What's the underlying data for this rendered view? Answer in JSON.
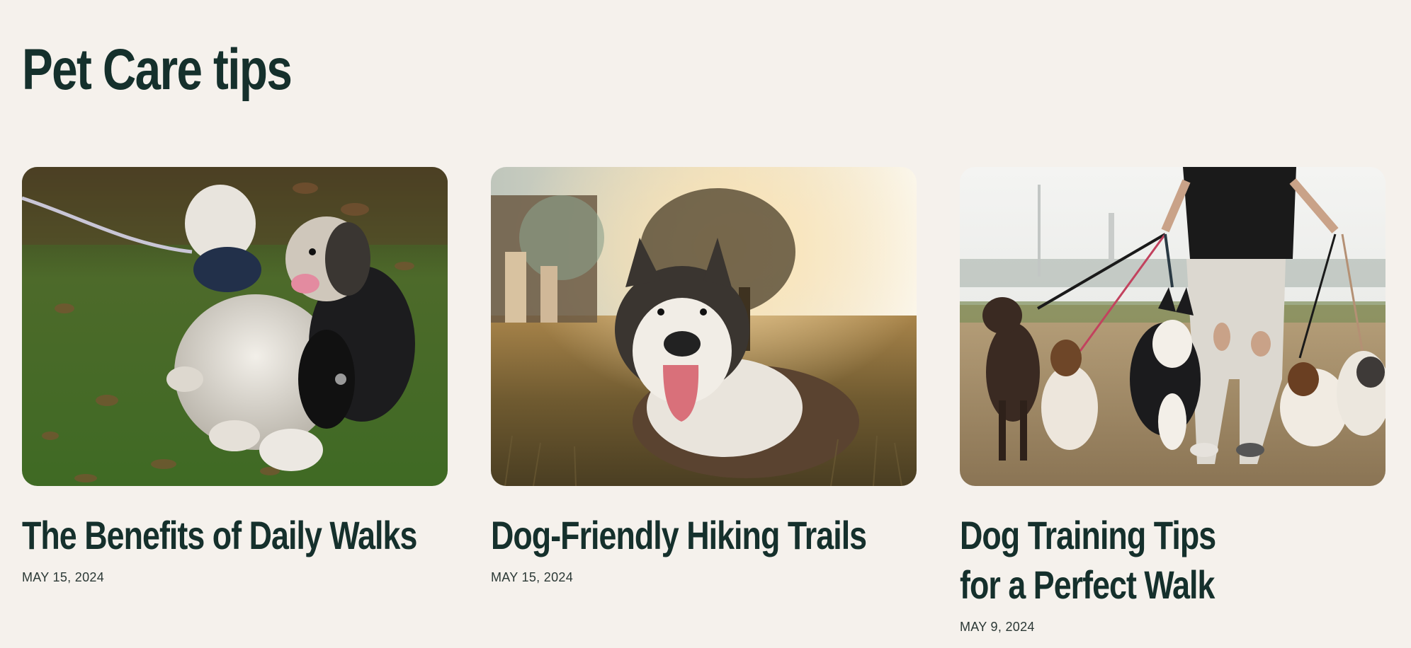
{
  "section": {
    "title": "Pet Care tips"
  },
  "posts": [
    {
      "title": "The Benefits of Daily Walks",
      "date": "MAY 15, 2024",
      "image_alt": "Two small shaggy dogs sitting on grass with leaves"
    },
    {
      "title": "Dog-Friendly Hiking Trails",
      "date": "MAY 15, 2024",
      "image_alt": "Husky lying in sunlit grass with tongue out"
    },
    {
      "title": "Dog Training Tips for a Perfect Walk",
      "date": "MAY 9, 2024",
      "image_alt": "Person walking several dogs on leashes along a dirt path"
    }
  ],
  "colors": {
    "background": "#f5f1ec",
    "heading": "#15302c",
    "date": "#2b3835"
  }
}
